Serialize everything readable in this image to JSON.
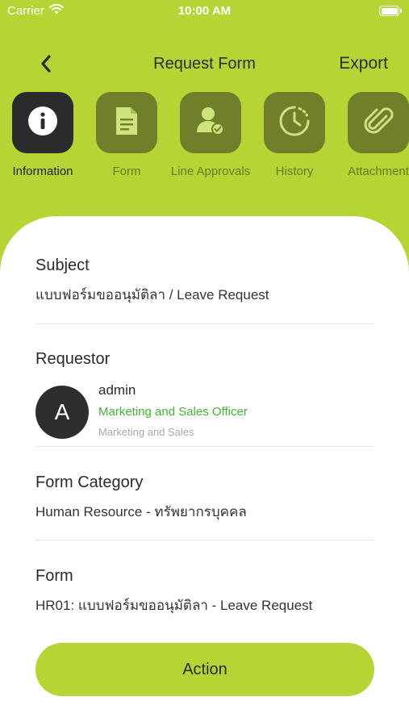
{
  "status_bar": {
    "carrier": "Carrier",
    "time": "10:00 AM",
    "wifi_icon": "wifi-icon",
    "battery_icon": "battery-icon"
  },
  "header": {
    "back_icon": "chevron-left-icon",
    "title": "Request Form",
    "export_label": "Export"
  },
  "tabs": [
    {
      "label": "Information",
      "icon": "info-icon",
      "active": true
    },
    {
      "label": "Form",
      "icon": "document-icon",
      "active": false
    },
    {
      "label": "Line Approvals",
      "icon": "user-check-icon",
      "active": false
    },
    {
      "label": "History",
      "icon": "history-icon",
      "active": false
    },
    {
      "label": "Attachment",
      "icon": "paperclip-icon",
      "active": false
    }
  ],
  "info": {
    "subject_label": "Subject",
    "subject_value": "แบบฟอร์มขออนุมัติลา / Leave Request",
    "requestor_label": "Requestor",
    "requestor": {
      "avatar_letter": "A",
      "name": "admin",
      "position": "Marketing and Sales Officer",
      "department": "Marketing and Sales"
    },
    "category_label": "Form Category",
    "category_value": "Human Resource - ทรัพยากรบุคคล",
    "form_label": "Form",
    "form_value": "HR01: แบบฟอร์มขออนุมัติลา - Leave Request"
  },
  "action_label": "Action",
  "colors": {
    "brand_green": "#b5d535",
    "tab_inactive": "#717f2a",
    "tab_active": "#2b2b2b",
    "position_text": "#3db82f"
  }
}
